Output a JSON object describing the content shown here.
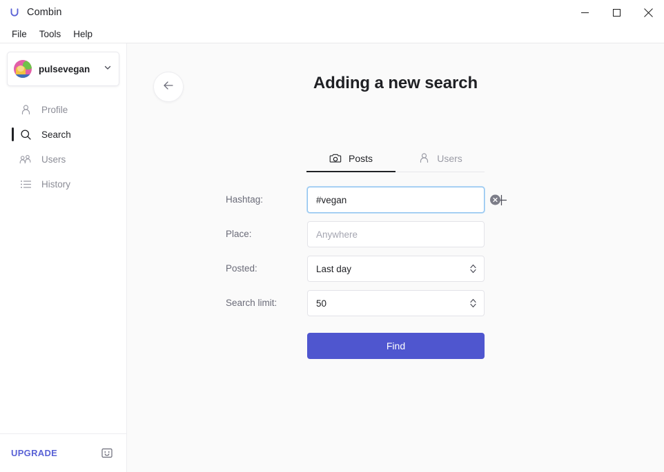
{
  "window": {
    "app_name": "Combin",
    "logo_icon": "combin-logo-icon",
    "minimize_label": "—",
    "maximize_label": "□",
    "close_label": "✕"
  },
  "menubar": {
    "items": [
      {
        "label": "File"
      },
      {
        "label": "Tools"
      },
      {
        "label": "Help"
      }
    ]
  },
  "sidebar": {
    "account": {
      "name": "pulsevegan",
      "avatar_icon": "user-avatar",
      "chevron_icon": "chevron-down-icon"
    },
    "nav": [
      {
        "label": "Profile",
        "icon": "person-icon",
        "active": false
      },
      {
        "label": "Search",
        "icon": "search-icon",
        "active": true
      },
      {
        "label": "Users",
        "icon": "people-icon",
        "active": false
      },
      {
        "label": "History",
        "icon": "list-icon",
        "active": false
      }
    ],
    "upgrade": {
      "label": "UPGRADE",
      "color": "#5a62d6",
      "feedback_icon": "smiley-chat-icon"
    }
  },
  "main": {
    "back_icon": "arrow-left-icon",
    "title": "Adding a new search",
    "tabs": [
      {
        "label": "Posts",
        "icon": "camera-icon",
        "active": true
      },
      {
        "label": "Users",
        "icon": "person-icon",
        "active": false
      }
    ],
    "form": {
      "hashtag": {
        "label": "Hashtag:",
        "value": "#vegan",
        "placeholder": "",
        "clear_icon": "clear-circle-icon",
        "add_icon": "plus-icon"
      },
      "place": {
        "label": "Place:",
        "value": "",
        "placeholder": "Anywhere"
      },
      "posted": {
        "label": "Posted:",
        "value": "Last day",
        "stepper_icon": "stepper-updown-icon"
      },
      "search_limit": {
        "label": "Search limit:",
        "value": "50",
        "stepper_icon": "stepper-updown-icon"
      },
      "find_button": {
        "label": "Find",
        "color": "#4f56cf"
      }
    }
  }
}
